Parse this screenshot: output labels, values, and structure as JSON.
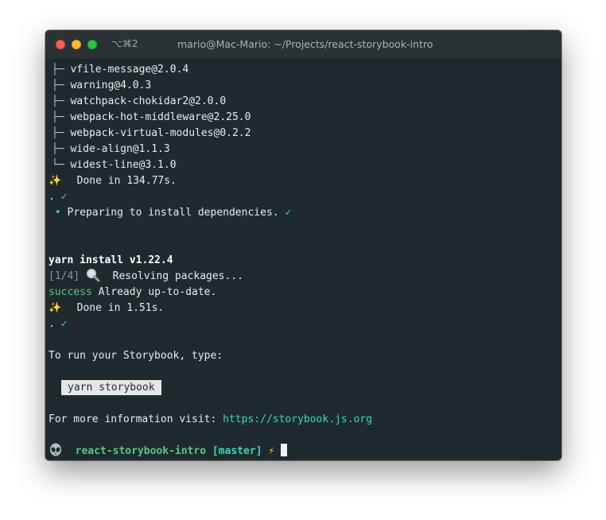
{
  "window": {
    "shortcut": "⌥⌘2",
    "title": "mario@Mac-Mario: ~/Projects/react-storybook-intro"
  },
  "terminal": {
    "tree_items": [
      {
        "branch": "├─",
        "text": "vfile-message@2.0.4"
      },
      {
        "branch": "├─",
        "text": "warning@4.0.3"
      },
      {
        "branch": "├─",
        "text": "watchpack-chokidar2@2.0.0"
      },
      {
        "branch": "├─",
        "text": "webpack-hot-middleware@2.25.0"
      },
      {
        "branch": "├─",
        "text": "webpack-virtual-modules@0.2.2"
      },
      {
        "branch": "├─",
        "text": "wide-align@1.1.3"
      },
      {
        "branch": "└─",
        "text": "widest-line@3.1.0"
      }
    ],
    "sparkle": "✨",
    "done1": "Done in 134.77s.",
    "dot": ".",
    "check": "✓",
    "bullet": "•",
    "preparing": "Preparing to install dependencies.",
    "yarn_install": "yarn install v1.22.4",
    "step": "[1/4]",
    "resolving": "Resolving packages...",
    "success_word": "success",
    "already": "Already up-to-date.",
    "done2": "Done in 1.51s.",
    "to_run": "To run your Storybook, type:",
    "command": "yarn storybook",
    "more_info": "For more information visit:",
    "url": "https://storybook.js.org",
    "prompt_dir": "react-storybook-intro",
    "prompt_branch": "[master]",
    "bolt": "⚡"
  }
}
